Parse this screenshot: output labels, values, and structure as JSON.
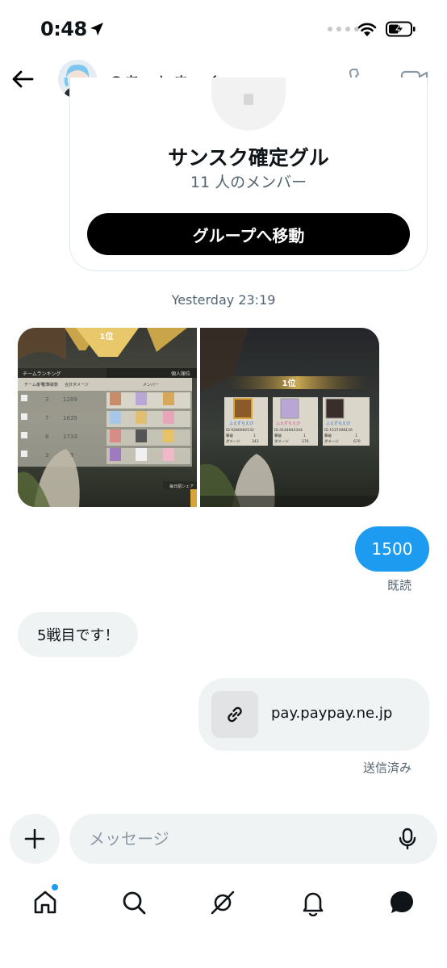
{
  "status_bar": {
    "time": "0:48"
  },
  "header": {
    "username": "@あっとまーく"
  },
  "group_card": {
    "name": "サンスク確定グル",
    "members": "11 人のメンバー",
    "button_label": "グループへ移動"
  },
  "timestamp": "Yesterday 23:19",
  "images": {
    "left": {
      "rank": "1位",
      "tab_team": "チームランキング",
      "tab_individual": "個人順位",
      "col_team": "チーム番号",
      "col_hits": "総撃破数",
      "col_damage": "合計ダメージ",
      "col_members": "メンバー",
      "rows": [
        {
          "hits": "3",
          "damage": "1289"
        },
        {
          "hits": "7",
          "damage": "1635"
        },
        {
          "hits": "8",
          "damage": "1733"
        },
        {
          "hits": "3",
          "damage": "639"
        }
      ],
      "footer": "毎日順シェア"
    },
    "right": {
      "rank": "1位",
      "players": [
        {
          "name": "ふえずらえび",
          "id": "ID 9280082532",
          "hits_label": "撃破",
          "hits": "1",
          "damage_label": "ダメージ",
          "damage": "343"
        },
        {
          "name": "ふえずらえび",
          "id": "ID 4144843344",
          "hits_label": "撃破",
          "hits": "1",
          "damage_label": "ダメージ",
          "damage": "276"
        },
        {
          "name": "ふえずらえび",
          "id": "ID 1537498126",
          "hits_label": "撃破",
          "hits": "1",
          "damage_label": "ダメージ",
          "damage": "670"
        }
      ]
    }
  },
  "messages": {
    "sent_1": "1500",
    "read_status": "既読",
    "received_1": "5戦目です！",
    "link_domain": "pay.paypay.ne.jp",
    "sent_status": "送信済み"
  },
  "composer": {
    "placeholder": "メッセージ"
  },
  "colors": {
    "accent": "#1d9bf0",
    "bubble_gray": "#eff3f4",
    "text_secondary": "#536471"
  },
  "nav": {
    "items": [
      "home-icon",
      "search-icon",
      "grok-icon",
      "notifications-icon",
      "messages-icon"
    ]
  }
}
